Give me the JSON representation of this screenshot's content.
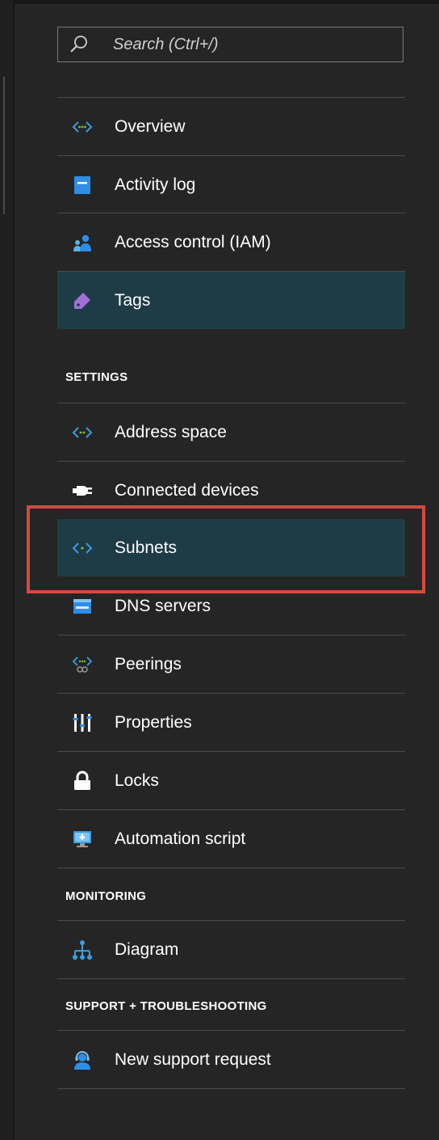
{
  "search": {
    "placeholder": "Search (Ctrl+/)"
  },
  "nav": {
    "items": [
      {
        "label": "Overview",
        "icon": "network-code-icon"
      },
      {
        "label": "Activity log",
        "icon": "activity-log-icon"
      },
      {
        "label": "Access control (IAM)",
        "icon": "users-icon"
      },
      {
        "label": "Tags",
        "icon": "tag-icon"
      }
    ]
  },
  "settings": {
    "heading": "SETTINGS",
    "items": [
      {
        "label": "Address space",
        "icon": "network-code-icon"
      },
      {
        "label": "Connected devices",
        "icon": "plug-icon"
      },
      {
        "label": "Subnets",
        "icon": "network-code-icon"
      },
      {
        "label": "DNS servers",
        "icon": "dns-icon"
      },
      {
        "label": "Peerings",
        "icon": "peering-icon"
      },
      {
        "label": "Properties",
        "icon": "properties-icon"
      },
      {
        "label": "Locks",
        "icon": "lock-icon"
      },
      {
        "label": "Automation script",
        "icon": "automation-monitor-icon"
      }
    ]
  },
  "monitoring": {
    "heading": "MONITORING",
    "items": [
      {
        "label": "Diagram",
        "icon": "diagram-icon"
      }
    ]
  },
  "support": {
    "heading": "SUPPORT + TROUBLESHOOTING",
    "items": [
      {
        "label": "New support request",
        "icon": "support-person-icon"
      }
    ]
  },
  "colors": {
    "background": "#252526",
    "active_item": "#1e3c45",
    "highlight_border": "#d4493f",
    "accent_blue": "#2f8de4",
    "accent_purple": "#a070d8"
  }
}
